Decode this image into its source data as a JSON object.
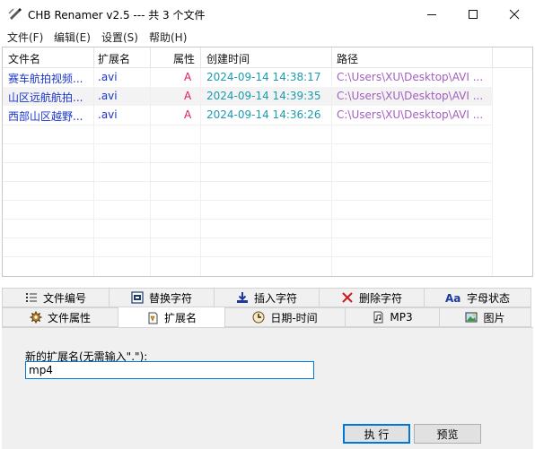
{
  "window": {
    "title": "CHB Renamer v2.5 --- 共 3 个文件",
    "minimize_glyph": "—",
    "maximize_glyph": "☐",
    "close_glyph": "✕"
  },
  "menu": [
    {
      "label": "文件(F)"
    },
    {
      "label": "编辑(E)"
    },
    {
      "label": "设置(S)"
    },
    {
      "label": "帮助(H)"
    }
  ],
  "file_list": {
    "columns": [
      "文件名",
      "扩展名",
      "属性",
      "创建时间",
      "路径"
    ],
    "rows": [
      {
        "name": "赛车航拍视频...",
        "ext": ".avi",
        "attr": "A",
        "created": "2024-09-14 14:38:17",
        "path": "C:\\Users\\XU\\Desktop\\AVI ..."
      },
      {
        "name": "山区远航航拍...",
        "ext": ".avi",
        "attr": "A",
        "created": "2024-09-14 14:39:35",
        "path": "C:\\Users\\XU\\Desktop\\AVI ..."
      },
      {
        "name": "西部山区越野...",
        "ext": ".avi",
        "attr": "A",
        "created": "2024-09-14 14:36:26",
        "path": "C:\\Users\\XU\\Desktop\\AVI ..."
      }
    ]
  },
  "tabs": {
    "row1": [
      {
        "label": "文件编号",
        "icon": "list-number-icon"
      },
      {
        "label": "替换字符",
        "icon": "replace-icon"
      },
      {
        "label": "插入字符",
        "icon": "insert-icon"
      },
      {
        "label": "删除字符",
        "icon": "delete-x-icon"
      },
      {
        "label": "字母状态",
        "icon": "letter-case-icon"
      }
    ],
    "row2": [
      {
        "label": "文件属性",
        "icon": "gear-icon"
      },
      {
        "label": "扩展名",
        "icon": "extension-icon"
      },
      {
        "label": "日期-时间",
        "icon": "clock-icon"
      },
      {
        "label": "MP3",
        "icon": "mp3-icon"
      },
      {
        "label": "图片",
        "icon": "picture-icon"
      }
    ],
    "active": "扩展名"
  },
  "extension_panel": {
    "label": "新的扩展名(无需输入\".\"):",
    "value": "mp4"
  },
  "buttons": {
    "execute": "执 行",
    "preview": "预览"
  },
  "colors": {
    "name": "#1a36c8",
    "attr": "#e2195a",
    "time": "#1a9bb0",
    "path": "#a25fbf"
  }
}
